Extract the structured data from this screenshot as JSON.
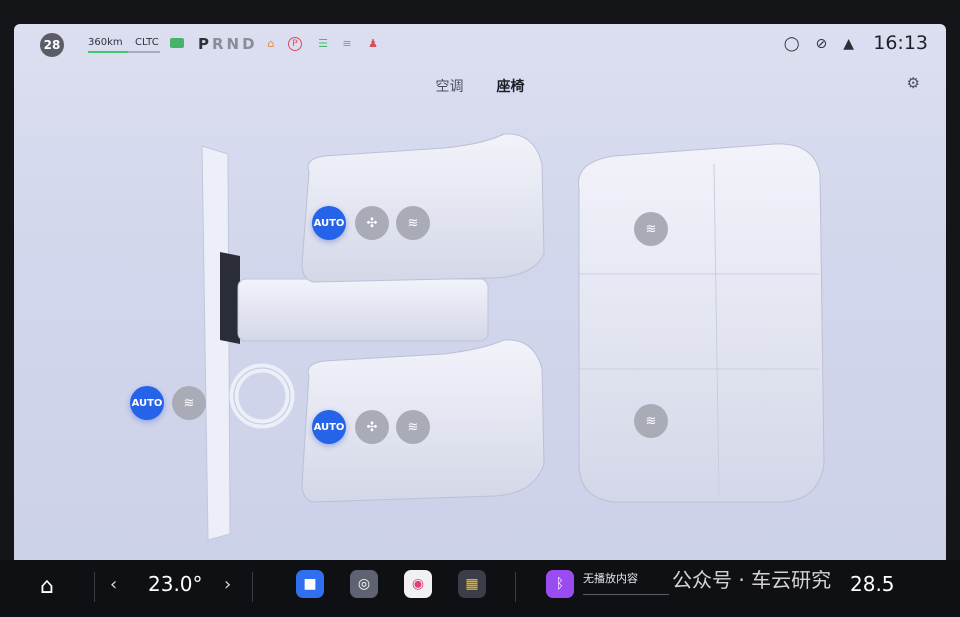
{
  "status_bar": {
    "speed_limit": "28",
    "range": "360km",
    "range_standard": "CLTC",
    "gear_p": "P",
    "gear_rnd": "RND",
    "time": "16:13",
    "colors": {
      "battery": "#47b36a",
      "warning_red": "#e04a5a",
      "warning_green": "#3fbf6a",
      "warning_orange": "#e58a3c"
    }
  },
  "tabs": [
    {
      "label": "空调",
      "active": false
    },
    {
      "label": "座椅",
      "active": true
    }
  ],
  "seats": {
    "front_left": {
      "auto_label": "AUTO",
      "vent_icon": "fan-icon",
      "heat_icon": "seat-heat-icon"
    },
    "front_right": {
      "auto_label": "AUTO",
      "vent_icon": "fan-icon",
      "heat_icon": "seat-heat-icon"
    },
    "steering": {
      "auto_label": "AUTO",
      "heat_icon": "wheel-heat-icon"
    },
    "rear_left": {
      "heat_icon": "seat-heat-icon"
    },
    "rear_right": {
      "heat_icon": "seat-heat-icon"
    }
  },
  "dock": {
    "temp_left": "23.0°",
    "temp_right": "28.5",
    "media_status": "无播放内容",
    "watermark": "公众号 · 车云研究",
    "apps": [
      "video-app-icon",
      "steering-app-icon",
      "p-app-icon",
      "apps-grid-icon",
      "bluetooth-icon"
    ]
  }
}
